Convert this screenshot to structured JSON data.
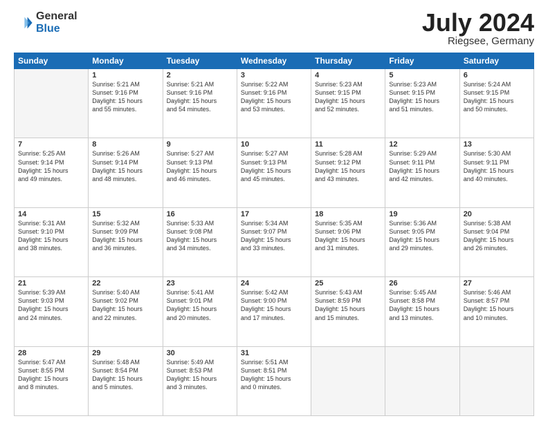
{
  "header": {
    "logo_general": "General",
    "logo_blue": "Blue",
    "title": "July 2024",
    "subtitle": "Riegsee, Germany"
  },
  "columns": [
    "Sunday",
    "Monday",
    "Tuesday",
    "Wednesday",
    "Thursday",
    "Friday",
    "Saturday"
  ],
  "weeks": [
    [
      {
        "day": "",
        "info": ""
      },
      {
        "day": "1",
        "info": "Sunrise: 5:21 AM\nSunset: 9:16 PM\nDaylight: 15 hours\nand 55 minutes."
      },
      {
        "day": "2",
        "info": "Sunrise: 5:21 AM\nSunset: 9:16 PM\nDaylight: 15 hours\nand 54 minutes."
      },
      {
        "day": "3",
        "info": "Sunrise: 5:22 AM\nSunset: 9:16 PM\nDaylight: 15 hours\nand 53 minutes."
      },
      {
        "day": "4",
        "info": "Sunrise: 5:23 AM\nSunset: 9:15 PM\nDaylight: 15 hours\nand 52 minutes."
      },
      {
        "day": "5",
        "info": "Sunrise: 5:23 AM\nSunset: 9:15 PM\nDaylight: 15 hours\nand 51 minutes."
      },
      {
        "day": "6",
        "info": "Sunrise: 5:24 AM\nSunset: 9:15 PM\nDaylight: 15 hours\nand 50 minutes."
      }
    ],
    [
      {
        "day": "7",
        "info": "Sunrise: 5:25 AM\nSunset: 9:14 PM\nDaylight: 15 hours\nand 49 minutes."
      },
      {
        "day": "8",
        "info": "Sunrise: 5:26 AM\nSunset: 9:14 PM\nDaylight: 15 hours\nand 48 minutes."
      },
      {
        "day": "9",
        "info": "Sunrise: 5:27 AM\nSunset: 9:13 PM\nDaylight: 15 hours\nand 46 minutes."
      },
      {
        "day": "10",
        "info": "Sunrise: 5:27 AM\nSunset: 9:13 PM\nDaylight: 15 hours\nand 45 minutes."
      },
      {
        "day": "11",
        "info": "Sunrise: 5:28 AM\nSunset: 9:12 PM\nDaylight: 15 hours\nand 43 minutes."
      },
      {
        "day": "12",
        "info": "Sunrise: 5:29 AM\nSunset: 9:11 PM\nDaylight: 15 hours\nand 42 minutes."
      },
      {
        "day": "13",
        "info": "Sunrise: 5:30 AM\nSunset: 9:11 PM\nDaylight: 15 hours\nand 40 minutes."
      }
    ],
    [
      {
        "day": "14",
        "info": "Sunrise: 5:31 AM\nSunset: 9:10 PM\nDaylight: 15 hours\nand 38 minutes."
      },
      {
        "day": "15",
        "info": "Sunrise: 5:32 AM\nSunset: 9:09 PM\nDaylight: 15 hours\nand 36 minutes."
      },
      {
        "day": "16",
        "info": "Sunrise: 5:33 AM\nSunset: 9:08 PM\nDaylight: 15 hours\nand 34 minutes."
      },
      {
        "day": "17",
        "info": "Sunrise: 5:34 AM\nSunset: 9:07 PM\nDaylight: 15 hours\nand 33 minutes."
      },
      {
        "day": "18",
        "info": "Sunrise: 5:35 AM\nSunset: 9:06 PM\nDaylight: 15 hours\nand 31 minutes."
      },
      {
        "day": "19",
        "info": "Sunrise: 5:36 AM\nSunset: 9:05 PM\nDaylight: 15 hours\nand 29 minutes."
      },
      {
        "day": "20",
        "info": "Sunrise: 5:38 AM\nSunset: 9:04 PM\nDaylight: 15 hours\nand 26 minutes."
      }
    ],
    [
      {
        "day": "21",
        "info": "Sunrise: 5:39 AM\nSunset: 9:03 PM\nDaylight: 15 hours\nand 24 minutes."
      },
      {
        "day": "22",
        "info": "Sunrise: 5:40 AM\nSunset: 9:02 PM\nDaylight: 15 hours\nand 22 minutes."
      },
      {
        "day": "23",
        "info": "Sunrise: 5:41 AM\nSunset: 9:01 PM\nDaylight: 15 hours\nand 20 minutes."
      },
      {
        "day": "24",
        "info": "Sunrise: 5:42 AM\nSunset: 9:00 PM\nDaylight: 15 hours\nand 17 minutes."
      },
      {
        "day": "25",
        "info": "Sunrise: 5:43 AM\nSunset: 8:59 PM\nDaylight: 15 hours\nand 15 minutes."
      },
      {
        "day": "26",
        "info": "Sunrise: 5:45 AM\nSunset: 8:58 PM\nDaylight: 15 hours\nand 13 minutes."
      },
      {
        "day": "27",
        "info": "Sunrise: 5:46 AM\nSunset: 8:57 PM\nDaylight: 15 hours\nand 10 minutes."
      }
    ],
    [
      {
        "day": "28",
        "info": "Sunrise: 5:47 AM\nSunset: 8:55 PM\nDaylight: 15 hours\nand 8 minutes."
      },
      {
        "day": "29",
        "info": "Sunrise: 5:48 AM\nSunset: 8:54 PM\nDaylight: 15 hours\nand 5 minutes."
      },
      {
        "day": "30",
        "info": "Sunrise: 5:49 AM\nSunset: 8:53 PM\nDaylight: 15 hours\nand 3 minutes."
      },
      {
        "day": "31",
        "info": "Sunrise: 5:51 AM\nSunset: 8:51 PM\nDaylight: 15 hours\nand 0 minutes."
      },
      {
        "day": "",
        "info": ""
      },
      {
        "day": "",
        "info": ""
      },
      {
        "day": "",
        "info": ""
      }
    ]
  ]
}
